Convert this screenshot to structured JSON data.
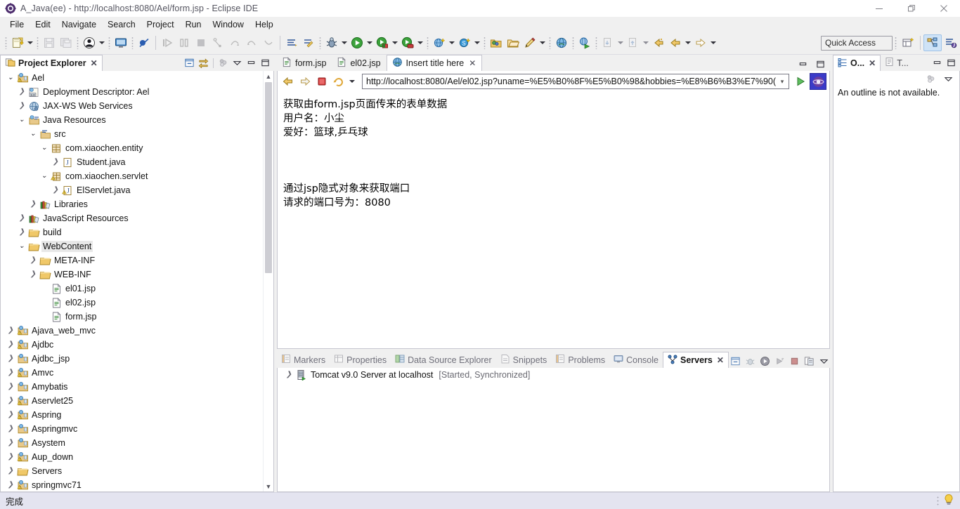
{
  "window": {
    "title": "A_Java(ee) - http://localhost:8080/Ael/form.jsp - Eclipse IDE",
    "icon": "eclipse-icon",
    "minimize_label": "Minimize",
    "restore_label": "Restore",
    "close_label": "Close"
  },
  "menubar": {
    "items": [
      {
        "label": "File"
      },
      {
        "label": "Edit"
      },
      {
        "label": "Navigate"
      },
      {
        "label": "Search"
      },
      {
        "label": "Project"
      },
      {
        "label": "Run"
      },
      {
        "label": "Window"
      },
      {
        "label": "Help"
      }
    ]
  },
  "toolbar": {
    "quick_access_placeholder": "Quick Access",
    "buttons": [
      {
        "name": "new-wizard",
        "icon": "new-file-icon",
        "has_dropdown": true,
        "enabled": true
      },
      {
        "name": "save",
        "icon": "save-icon",
        "has_dropdown": false,
        "enabled": false
      },
      {
        "name": "save-all",
        "icon": "save-all-icon",
        "has_dropdown": false,
        "enabled": false
      },
      {
        "name": "user",
        "icon": "user-icon",
        "has_dropdown": true,
        "enabled": true
      },
      {
        "name": "terminal",
        "icon": "terminal-icon",
        "has_dropdown": false,
        "enabled": true
      },
      {
        "name": "skip-breakpoints",
        "icon": "skip-breakpoints-icon",
        "has_dropdown": false,
        "enabled": true
      },
      {
        "name": "resume",
        "icon": "resume-icon",
        "has_dropdown": false,
        "enabled": false
      },
      {
        "name": "suspend",
        "icon": "suspend-icon",
        "has_dropdown": false,
        "enabled": false
      },
      {
        "name": "terminate",
        "icon": "terminate-icon",
        "has_dropdown": false,
        "enabled": false
      },
      {
        "name": "step-into",
        "icon": "step-into-icon",
        "has_dropdown": false,
        "enabled": false
      },
      {
        "name": "step-over",
        "icon": "step-over-icon",
        "has_dropdown": false,
        "enabled": false
      },
      {
        "name": "step-return",
        "icon": "step-return-icon",
        "has_dropdown": false,
        "enabled": false
      },
      {
        "name": "drop-to-frame",
        "icon": "drop-to-frame-icon",
        "has_dropdown": false,
        "enabled": false
      },
      {
        "name": "new-java-package",
        "icon": "package-icon",
        "has_dropdown": false,
        "enabled": true
      },
      {
        "name": "new-java-class",
        "icon": "new-class-icon",
        "has_dropdown": false,
        "enabled": true
      },
      {
        "name": "debug",
        "icon": "debug-bug-icon",
        "has_dropdown": true,
        "enabled": true
      },
      {
        "name": "run",
        "icon": "run-green-icon",
        "has_dropdown": true,
        "enabled": true
      },
      {
        "name": "run-server",
        "icon": "run-server-icon",
        "has_dropdown": true,
        "enabled": true
      },
      {
        "name": "run-profile",
        "icon": "profile-icon",
        "has_dropdown": true,
        "enabled": true
      },
      {
        "name": "new-web-project",
        "icon": "web-project-icon",
        "has_dropdown": true,
        "enabled": true
      },
      {
        "name": "new-svn",
        "icon": "svn-icon",
        "has_dropdown": true,
        "enabled": true
      },
      {
        "name": "open-type",
        "icon": "open-folder-icon",
        "has_dropdown": false,
        "enabled": true
      },
      {
        "name": "open-resource",
        "icon": "open-resource-icon",
        "has_dropdown": false,
        "enabled": true
      },
      {
        "name": "search-pencil",
        "icon": "pencil-icon",
        "has_dropdown": true,
        "enabled": true
      },
      {
        "name": "open-web-browser",
        "icon": "globe-icon",
        "has_dropdown": false,
        "enabled": true
      },
      {
        "name": "external-tools",
        "icon": "external-tools-icon",
        "has_dropdown": false,
        "enabled": true
      },
      {
        "name": "next-annotation",
        "icon": "next-annotation-icon",
        "has_dropdown": true,
        "enabled": false
      },
      {
        "name": "previous-annotation",
        "icon": "previous-annotation-icon",
        "has_dropdown": true,
        "enabled": false
      },
      {
        "name": "last-edit-location",
        "icon": "last-edit-icon",
        "has_dropdown": false,
        "enabled": true
      },
      {
        "name": "back",
        "icon": "back-arrow-icon",
        "has_dropdown": true,
        "enabled": true
      },
      {
        "name": "forward",
        "icon": "forward-arrow-icon",
        "has_dropdown": true,
        "enabled": false
      }
    ],
    "perspective": {
      "open_perspective": "open-perspective-icon",
      "java_ee_perspective": "java-ee-perspective-icon",
      "java_perspective": "java-perspective-icon"
    }
  },
  "project_explorer": {
    "title": "Project Explorer",
    "close_label": "✕",
    "tools": [
      {
        "name": "collapse-all-icon"
      },
      {
        "name": "link-with-editor-icon"
      },
      {
        "name": "view-menu-dots-icon"
      },
      {
        "name": "view-menu-icon"
      },
      {
        "name": "minimize-icon"
      },
      {
        "name": "maximize-icon"
      }
    ],
    "tree": [
      {
        "label": "Ael",
        "depth": 0,
        "expander": "open",
        "icon": "web-project-warn-icon",
        "selected": false
      },
      {
        "label": "Deployment Descriptor: Ael",
        "depth": 1,
        "expander": "closed",
        "icon": "deployment-descriptor-icon",
        "selected": false
      },
      {
        "label": "JAX-WS Web Services",
        "depth": 1,
        "expander": "closed",
        "icon": "jaxws-icon",
        "selected": false
      },
      {
        "label": "Java Resources",
        "depth": 1,
        "expander": "open",
        "icon": "java-resources-icon",
        "selected": false
      },
      {
        "label": "src",
        "depth": 2,
        "expander": "open",
        "icon": "source-folder-icon",
        "selected": false
      },
      {
        "label": "com.xiaochen.entity",
        "depth": 3,
        "expander": "open",
        "icon": "package-icon",
        "selected": false
      },
      {
        "label": "Student.java",
        "depth": 4,
        "expander": "closed",
        "icon": "java-file-icon",
        "selected": false
      },
      {
        "label": "com.xiaochen.servlet",
        "depth": 3,
        "expander": "open",
        "icon": "package-warn-icon",
        "selected": false
      },
      {
        "label": "ElServlet.java",
        "depth": 4,
        "expander": "closed",
        "icon": "java-file-warn-icon",
        "selected": false
      },
      {
        "label": "Libraries",
        "depth": 2,
        "expander": "closed",
        "icon": "libraries-icon",
        "selected": false
      },
      {
        "label": "JavaScript Resources",
        "depth": 1,
        "expander": "closed",
        "icon": "libraries-icon",
        "selected": false
      },
      {
        "label": "build",
        "depth": 1,
        "expander": "closed",
        "icon": "folder-icon",
        "selected": false
      },
      {
        "label": "WebContent",
        "depth": 1,
        "expander": "open",
        "icon": "folder-icon",
        "selected": true
      },
      {
        "label": "META-INF",
        "depth": 2,
        "expander": "closed",
        "icon": "folder-icon",
        "selected": false
      },
      {
        "label": "WEB-INF",
        "depth": 2,
        "expander": "closed",
        "icon": "folder-icon",
        "selected": false
      },
      {
        "label": "el01.jsp",
        "depth": 3,
        "expander": "none",
        "icon": "jsp-file-icon",
        "selected": false
      },
      {
        "label": "el02.jsp",
        "depth": 3,
        "expander": "none",
        "icon": "jsp-file-icon",
        "selected": false
      },
      {
        "label": "form.jsp",
        "depth": 3,
        "expander": "none",
        "icon": "jsp-file-icon",
        "selected": false
      },
      {
        "label": "Ajava_web_mvc",
        "depth": 0,
        "expander": "closed",
        "icon": "web-project-warn-icon",
        "selected": false
      },
      {
        "label": "Ajdbc",
        "depth": 0,
        "expander": "closed",
        "icon": "web-project-warn-icon",
        "selected": false
      },
      {
        "label": "Ajdbc_jsp",
        "depth": 0,
        "expander": "closed",
        "icon": "web-project-icon",
        "selected": false
      },
      {
        "label": "Amvc",
        "depth": 0,
        "expander": "closed",
        "icon": "web-project-warn-icon",
        "selected": false
      },
      {
        "label": "Amybatis",
        "depth": 0,
        "expander": "closed",
        "icon": "web-project-icon",
        "selected": false
      },
      {
        "label": "Aservlet25",
        "depth": 0,
        "expander": "closed",
        "icon": "web-project-warn-icon",
        "selected": false
      },
      {
        "label": "Aspring",
        "depth": 0,
        "expander": "closed",
        "icon": "web-project-warn-icon",
        "selected": false
      },
      {
        "label": "Aspringmvc",
        "depth": 0,
        "expander": "closed",
        "icon": "web-project-icon",
        "selected": false
      },
      {
        "label": "Asystem",
        "depth": 0,
        "expander": "closed",
        "icon": "web-project-icon",
        "selected": false
      },
      {
        "label": "Aup_down",
        "depth": 0,
        "expander": "closed",
        "icon": "web-project-warn-icon",
        "selected": false
      },
      {
        "label": "Servers",
        "depth": 0,
        "expander": "closed",
        "icon": "folder-icon",
        "selected": false
      },
      {
        "label": "springmvc71",
        "depth": 0,
        "expander": "closed",
        "icon": "web-project-warn-icon",
        "selected": false
      }
    ]
  },
  "editor": {
    "tabs": [
      {
        "label": "form.jsp",
        "icon": "jsp-file-icon",
        "active": false,
        "closable": false
      },
      {
        "label": "el02.jsp",
        "icon": "jsp-file-icon",
        "active": false,
        "closable": false
      },
      {
        "label": "Insert title here",
        "icon": "globe-icon",
        "active": true,
        "closable": true
      }
    ],
    "tab_close_label": "✕",
    "tools": [
      {
        "name": "minimize-icon"
      },
      {
        "name": "maximize-icon"
      }
    ],
    "browser": {
      "back_label": "back-arrow-icon",
      "forward_label": "forward-arrow-icon",
      "stop_label": "stop-icon",
      "refresh_label": "refresh-icon",
      "url": "http://localhost:8080/Ael/el02.jsp?uname=%E5%B0%8F%E5%B0%98&hobbies=%E8%B6%B3%E7%90(",
      "go_label": "go-icon",
      "browser_icon": "internal-browser-icon"
    },
    "page": {
      "lines": [
        "获取由form.jsp页面传来的表单数据",
        "用户名：小尘",
        "爱好：篮球,乒乓球"
      ],
      "lines2": [
        "通过jsp隐式对象来获取端口",
        "请求的端口号为：8080"
      ]
    }
  },
  "outline": {
    "tabs": [
      {
        "label": "O...",
        "icon": "outline-icon",
        "active": true,
        "closable": true
      },
      {
        "label": "T...",
        "icon": "task-list-icon",
        "active": false,
        "closable": false
      }
    ],
    "tab_close_label": "✕",
    "tools": [
      {
        "name": "minimize-icon"
      },
      {
        "name": "maximize-icon"
      }
    ],
    "body_tools": [
      {
        "name": "view-menu-dots-icon"
      },
      {
        "name": "view-menu-icon"
      }
    ],
    "message": "An outline is not available."
  },
  "bottom_panel": {
    "tabs": [
      {
        "label": "Markers",
        "icon": "markers-icon",
        "active": false,
        "closable": false
      },
      {
        "label": "Properties",
        "icon": "properties-icon",
        "active": false,
        "closable": false
      },
      {
        "label": "Data Source Explorer",
        "icon": "data-source-icon",
        "active": false,
        "closable": false
      },
      {
        "label": "Snippets",
        "icon": "snippets-icon",
        "active": false,
        "closable": false
      },
      {
        "label": "Problems",
        "icon": "problems-icon",
        "active": false,
        "closable": false
      },
      {
        "label": "Console",
        "icon": "console-icon",
        "active": false,
        "closable": false
      },
      {
        "label": "Servers",
        "icon": "servers-icon",
        "active": true,
        "closable": true
      }
    ],
    "tab_close_label": "✕",
    "tools": [
      {
        "name": "collapse-all-icon"
      },
      {
        "name": "debug-server-icon"
      },
      {
        "name": "start-server-icon"
      },
      {
        "name": "profile-server-icon"
      },
      {
        "name": "stop-server-icon"
      },
      {
        "name": "publish-icon"
      },
      {
        "name": "view-menu-icon"
      },
      {
        "name": "minimize-icon"
      },
      {
        "name": "maximize-icon"
      }
    ],
    "servers": [
      {
        "name": "Tomcat v9.0 Server at localhost",
        "state": "[Started, Synchronized]",
        "icon": "server-started-icon",
        "expander": "closed"
      }
    ]
  },
  "statusbar": {
    "text": "完成",
    "tip_icon": "lightbulb-icon"
  },
  "colors": {
    "accent": "#cfe3f7",
    "tab_active_bg": "#ffffff",
    "panel_bg": "#f0f0f0",
    "border": "#c6c6cf",
    "statusbar_bg": "#e4e4f0",
    "selection_bg": "#e8e8e8",
    "folder_yellow": "#f0c040",
    "link_blue": "#2a5db0"
  }
}
